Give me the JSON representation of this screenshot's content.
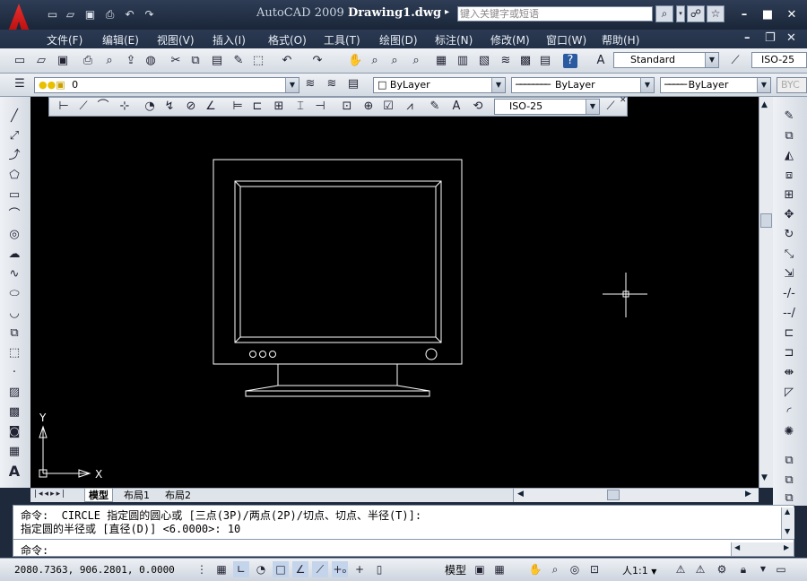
{
  "window": {
    "app_name": "AutoCAD 2009",
    "document": "Drawing1.dwg",
    "search_placeholder": "键入关键字或短语",
    "arrow": "▸"
  },
  "menu": [
    "文件(F)",
    "编辑(E)",
    "视图(V)",
    "插入(I)",
    "格式(O)",
    "工具(T)",
    "绘图(D)",
    "标注(N)",
    "修改(M)",
    "窗口(W)",
    "帮助(H)"
  ],
  "toolbars": {
    "text_style": "Standard",
    "dim_style": "ISO-25",
    "layer": "0",
    "color": "ByLayer",
    "linetype": "ByLayer",
    "lineweight": "ByLayer",
    "plotstyle": "BYC",
    "dim_toolbar_style": "ISO-25"
  },
  "ucs": {
    "x_label": "X",
    "y_label": "Y"
  },
  "layout_tabs": [
    "模型",
    "布局1",
    "布局2"
  ],
  "command": {
    "line1": "命令:  CIRCLE 指定圆的圆心或 [三点(3P)/两点(2P)/切点、切点、半径(T)]:",
    "line2": "指定圆的半径或 [直径(D)] <6.0000>: 10",
    "prompt": "命令:"
  },
  "status": {
    "coordinates": "2080.7363, 906.2801, 0.0000",
    "model_label": "模型",
    "annotation_scale": "人1:1",
    "scale_arrow": "▼"
  },
  "colors": {
    "canvas": "#000000",
    "drawing": "#ffffff",
    "titlebar": "#1e2a3c"
  }
}
